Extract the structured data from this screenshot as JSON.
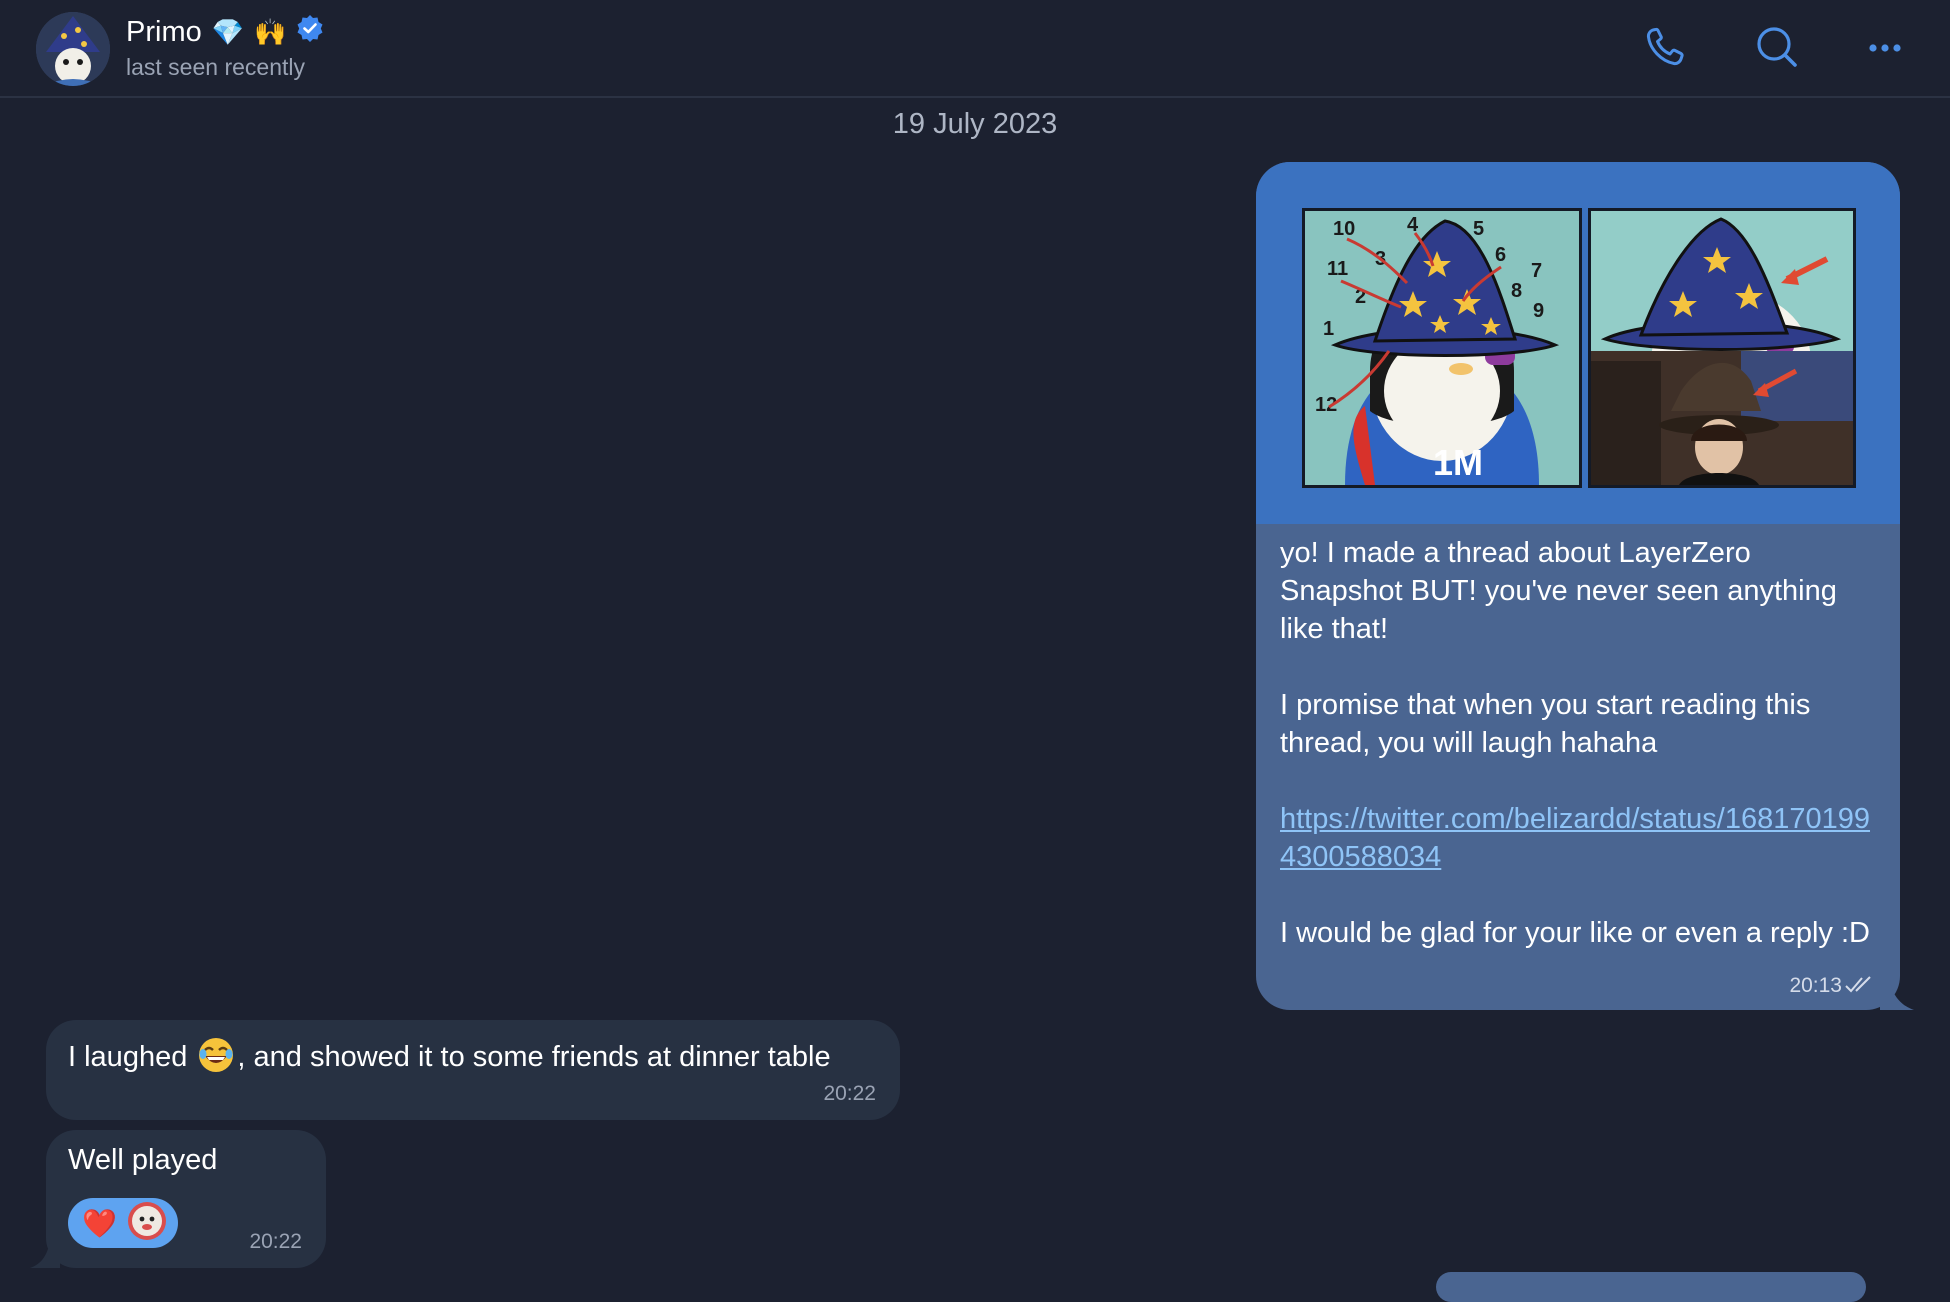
{
  "header": {
    "contact_name": "Primo",
    "name_emojis": [
      "💎",
      "🙌"
    ],
    "status": "last seen recently",
    "icons": [
      "phone-icon",
      "search-icon",
      "more-icon"
    ]
  },
  "date_separator": "19 July 2023",
  "outgoing_message": {
    "paragraphs": [
      "yo! I made a thread about LayerZero Snapshot BUT! you've never seen anything like that!",
      "I promise that when you start reading this thread, you will laugh hahaha"
    ],
    "link": "https://twitter.com/belizardd/status/1681701994300588034",
    "closing": "I would be glad for your like or even a reply :D",
    "time": "20:13",
    "media_images": [
      {
        "numbers_on_clock": [
          "10",
          "4",
          "5",
          "3",
          "6",
          "11",
          "7",
          "2",
          "8",
          "9",
          "1",
          "12"
        ],
        "shirt_text": "1M"
      },
      {}
    ]
  },
  "incoming_messages": [
    {
      "text_before": "I laughed ",
      "text_after": ", and showed it to some friends at dinner table",
      "time": "20:22"
    },
    {
      "text": "Well played",
      "time": "20:22",
      "reaction": "❤️"
    }
  ],
  "colors": {
    "background": "#1c2130",
    "outgoing_bubble": "#4a6591",
    "incoming_bubble": "#273142",
    "accent": "#4c8fe6",
    "link": "#8fc4f7"
  }
}
